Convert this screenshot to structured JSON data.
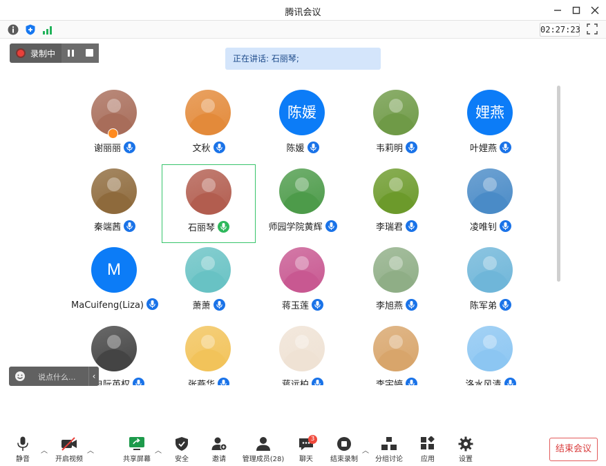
{
  "window": {
    "title": "腾讯会议",
    "minimize_icon": "minimize-icon",
    "maximize_icon": "maximize-icon",
    "close_icon": "close-icon"
  },
  "info_bar": {
    "timer": "02:27:23",
    "icons": [
      "info-icon",
      "shield-icon",
      "signal-icon",
      "fullscreen-icon"
    ]
  },
  "recording": {
    "label": "录制中"
  },
  "speaking": {
    "text": "正在讲话: 石丽琴;"
  },
  "participants": [
    {
      "name": "谢丽丽",
      "avatar": "photo",
      "color": "#a86d5a",
      "host": true
    },
    {
      "name": "文秋",
      "avatar": "photo",
      "color": "#e38a3a"
    },
    {
      "name": "陈媛",
      "avatar": "text",
      "avatar_text": "陈媛"
    },
    {
      "name": "韦莉明",
      "avatar": "photo",
      "color": "#6f9a47"
    },
    {
      "name": "叶娌燕",
      "avatar": "text",
      "avatar_text": "娌燕"
    },
    {
      "name": "秦端茜",
      "avatar": "photo",
      "color": "#8e6a3c"
    },
    {
      "name": "石丽琴",
      "avatar": "photo",
      "color": "#b25d4f",
      "active": true
    },
    {
      "name": "师园学院黄辉",
      "avatar": "photo",
      "color": "#4d9b4a"
    },
    {
      "name": "李瑞君",
      "avatar": "photo",
      "color": "#6c9a2b"
    },
    {
      "name": "凌唯钊",
      "avatar": "photo",
      "color": "#4a8bc7"
    },
    {
      "name": "MaCuifeng(Liza)",
      "avatar": "text",
      "avatar_text": "M"
    },
    {
      "name": "萧萧",
      "avatar": "photo",
      "color": "#68c2c4"
    },
    {
      "name": "蒋玉莲",
      "avatar": "photo",
      "color": "#c85891"
    },
    {
      "name": "李旭燕",
      "avatar": "photo",
      "color": "#8fae86"
    },
    {
      "name": "陈军弟",
      "avatar": "photo",
      "color": "#6fb6d9"
    },
    {
      "name": "机电阮英权",
      "avatar": "photo",
      "color": "#444444"
    },
    {
      "name": "张燕华",
      "avatar": "photo",
      "color": "#f2c35a"
    },
    {
      "name": "蒋远柏",
      "avatar": "photo",
      "color": "#efe2d4"
    },
    {
      "name": "李宇婷",
      "avatar": "photo",
      "color": "#d8a56b"
    },
    {
      "name": "洛水风清",
      "avatar": "photo",
      "color": "#8cc6f2"
    }
  ],
  "chat": {
    "placeholder": "说点什么..."
  },
  "bottom": {
    "mute": "静音",
    "video": "开启视频",
    "share": "共享屏幕",
    "security": "安全",
    "invite": "邀请",
    "members": "管理成员(28)",
    "chat": "聊天",
    "chat_badge": "3",
    "end_record": "结束录制",
    "breakout": "分组讨论",
    "apps": "应用",
    "settings": "设置",
    "end_meeting": "结束会议"
  },
  "colors": {
    "accent": "#0c7cf7",
    "active_border": "#36c46a",
    "danger": "#d93a3a",
    "share_green": "#1d9a4b"
  }
}
